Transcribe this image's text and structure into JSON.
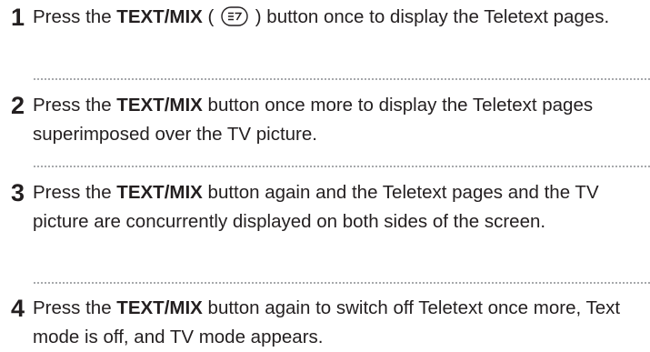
{
  "steps": [
    {
      "number": "1",
      "pre": "Press the ",
      "bold": "TEXT/MIX",
      "post": " ) button once to display the Teletext pages.",
      "paren_open": " (",
      "icon": "teletext-mix-button-icon"
    },
    {
      "number": "2",
      "pre": "Press the ",
      "bold": "TEXT/MIX",
      "post": " button once more to display the Teletext pages superimposed over the TV picture."
    },
    {
      "number": "3",
      "pre": "Press the ",
      "bold": "TEXT/MIX",
      "post": " button again and the Teletext pages and the TV picture are concurrently displayed on both sides of the screen."
    },
    {
      "number": "4",
      "pre": "Press the ",
      "bold": "TEXT/MIX",
      "post": " button again to switch off Teletext once more, Text mode is off, and TV mode appears."
    }
  ]
}
